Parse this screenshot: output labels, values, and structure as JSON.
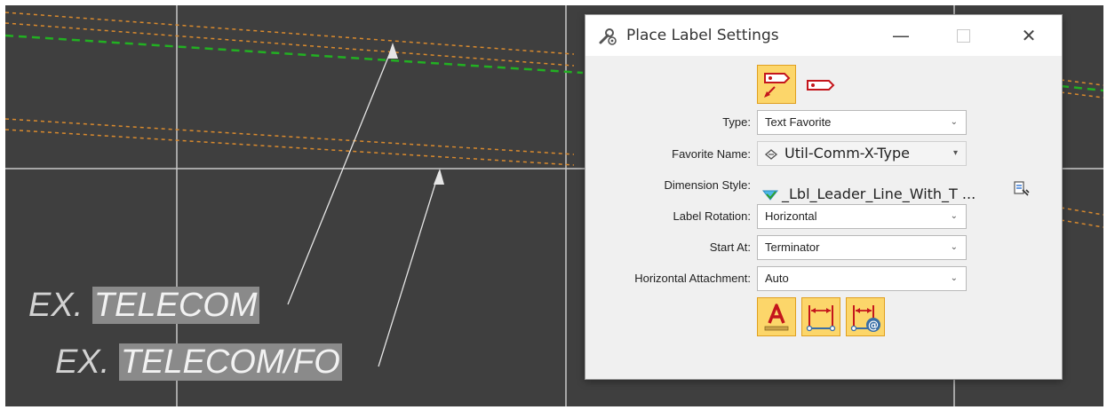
{
  "cad": {
    "labels": [
      {
        "prefix": "EX. ",
        "highlight": "TELECOM"
      },
      {
        "prefix": "EX. ",
        "highlight": "TELECOM/FO"
      }
    ],
    "colors": {
      "background": "#3f3f3f",
      "grid": "#c8c8c8",
      "green_line": "#22b022",
      "orange_line": "#d98a2e",
      "leader": "#e6e6e6"
    }
  },
  "dialog": {
    "title": "Place Label Settings",
    "title_icon": "wrench-gear-icon",
    "controls": {
      "minimize": "—",
      "close": "✕"
    },
    "mode_buttons": [
      {
        "icon": "label-with-leader-icon",
        "active": true
      },
      {
        "icon": "label-tag-icon",
        "active": false
      }
    ],
    "fields": {
      "type": {
        "label": "Type:",
        "value": "Text Favorite"
      },
      "favorite_name": {
        "label": "Favorite Name:",
        "value": "Util-Comm-X-Type",
        "icon": "text-favorite-icon"
      },
      "dimension_style": {
        "label": "Dimension Style:",
        "value": "_Lbl_Leader_Line_With_T ...",
        "icon": "dimension-style-icon",
        "pick_icon": "pick-style-icon"
      },
      "label_rotation": {
        "label": "Label Rotation:",
        "value": "Horizontal"
      },
      "start_at": {
        "label": "Start At:",
        "value": "Terminator"
      },
      "horizontal_attachment": {
        "label": "Horizontal Attachment:",
        "value": "Auto"
      }
    },
    "bottom_tools": [
      {
        "icon": "text-a-icon",
        "active": true
      },
      {
        "icon": "dimension-extent-icon",
        "active": true
      },
      {
        "icon": "dimension-at-icon",
        "active": true
      }
    ],
    "accent": "#fcd66a"
  }
}
